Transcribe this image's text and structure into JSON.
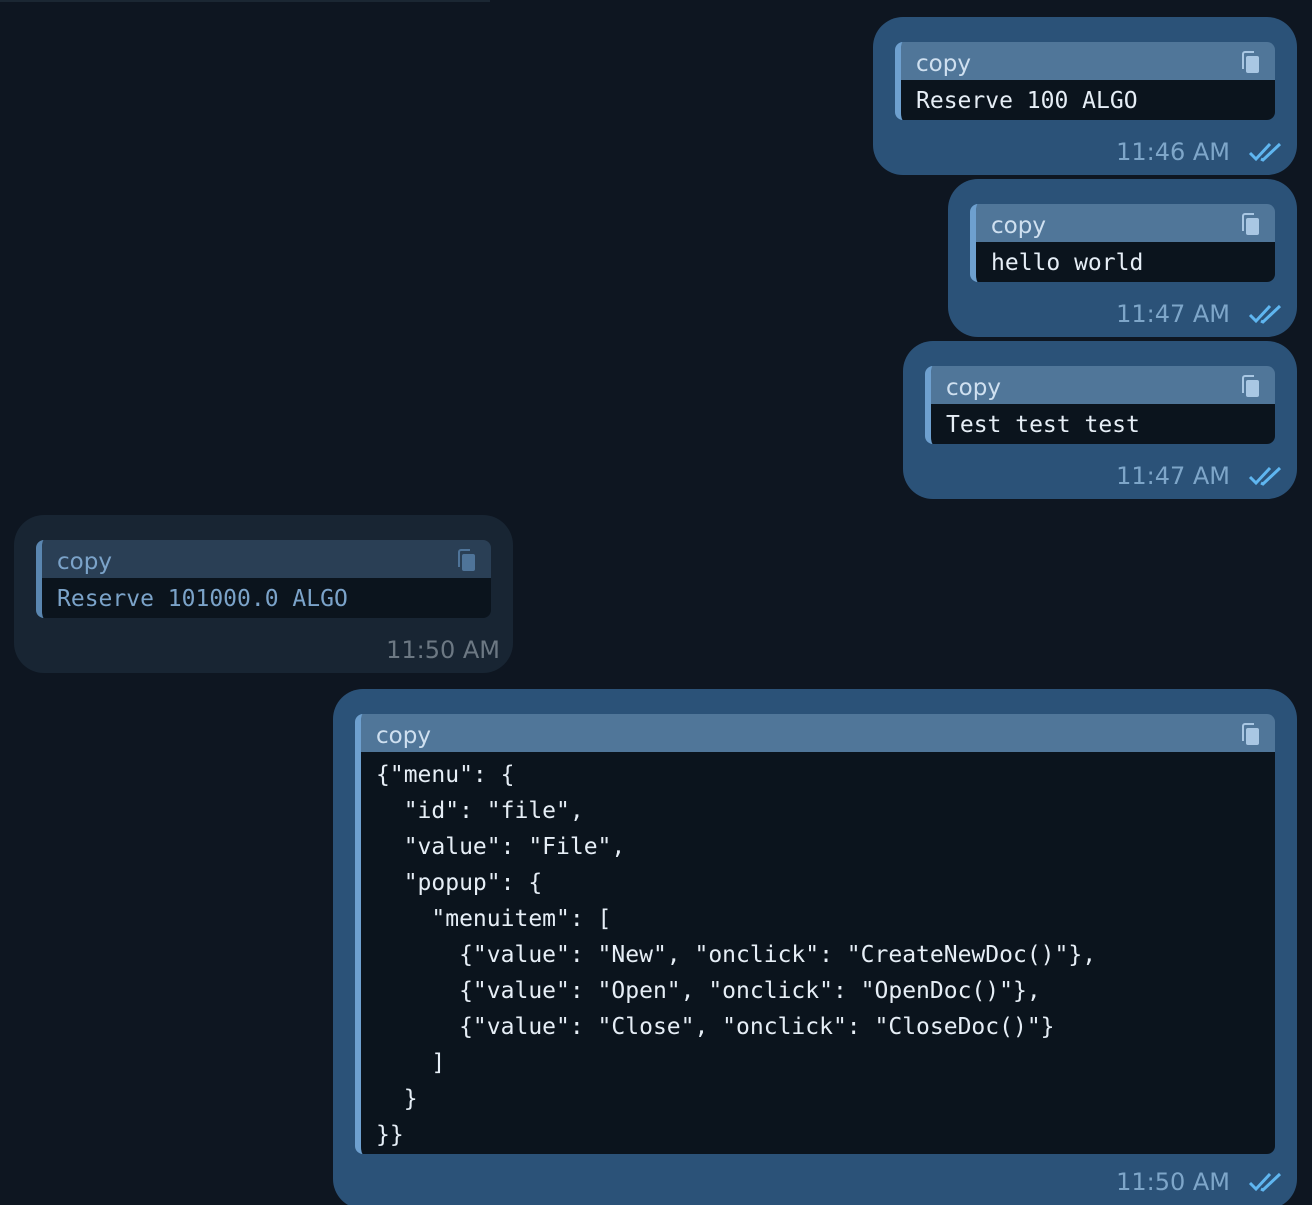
{
  "colors": {
    "background": "#0e1621",
    "outgoing_bubble": "#2b5278",
    "incoming_bubble": "#182533",
    "read_check": "#5fb6f0"
  },
  "copy_icon": "copy-icon",
  "read_icon": "double-check-icon",
  "messages": [
    {
      "direction": "outgoing",
      "code_label": "copy",
      "code": "Reserve 100 ALGO",
      "time": "11:46 AM",
      "read": true
    },
    {
      "direction": "outgoing",
      "code_label": "copy",
      "code": "hello world",
      "time": "11:47 AM",
      "read": true
    },
    {
      "direction": "outgoing",
      "code_label": "copy",
      "code": "Test test test",
      "time": "11:47 AM",
      "read": true
    },
    {
      "direction": "incoming",
      "code_label": "copy",
      "code": "Reserve 101000.0 ALGO",
      "time": "11:50 AM",
      "read": false
    },
    {
      "direction": "outgoing",
      "code_label": "copy",
      "code": "{\"menu\": {\n  \"id\": \"file\",\n  \"value\": \"File\",\n  \"popup\": {\n    \"menuitem\": [\n      {\"value\": \"New\", \"onclick\": \"CreateNewDoc()\"},\n      {\"value\": \"Open\", \"onclick\": \"OpenDoc()\"},\n      {\"value\": \"Close\", \"onclick\": \"CloseDoc()\"}\n    ]\n  }\n}}",
      "time": "11:50 AM",
      "read": true
    }
  ]
}
